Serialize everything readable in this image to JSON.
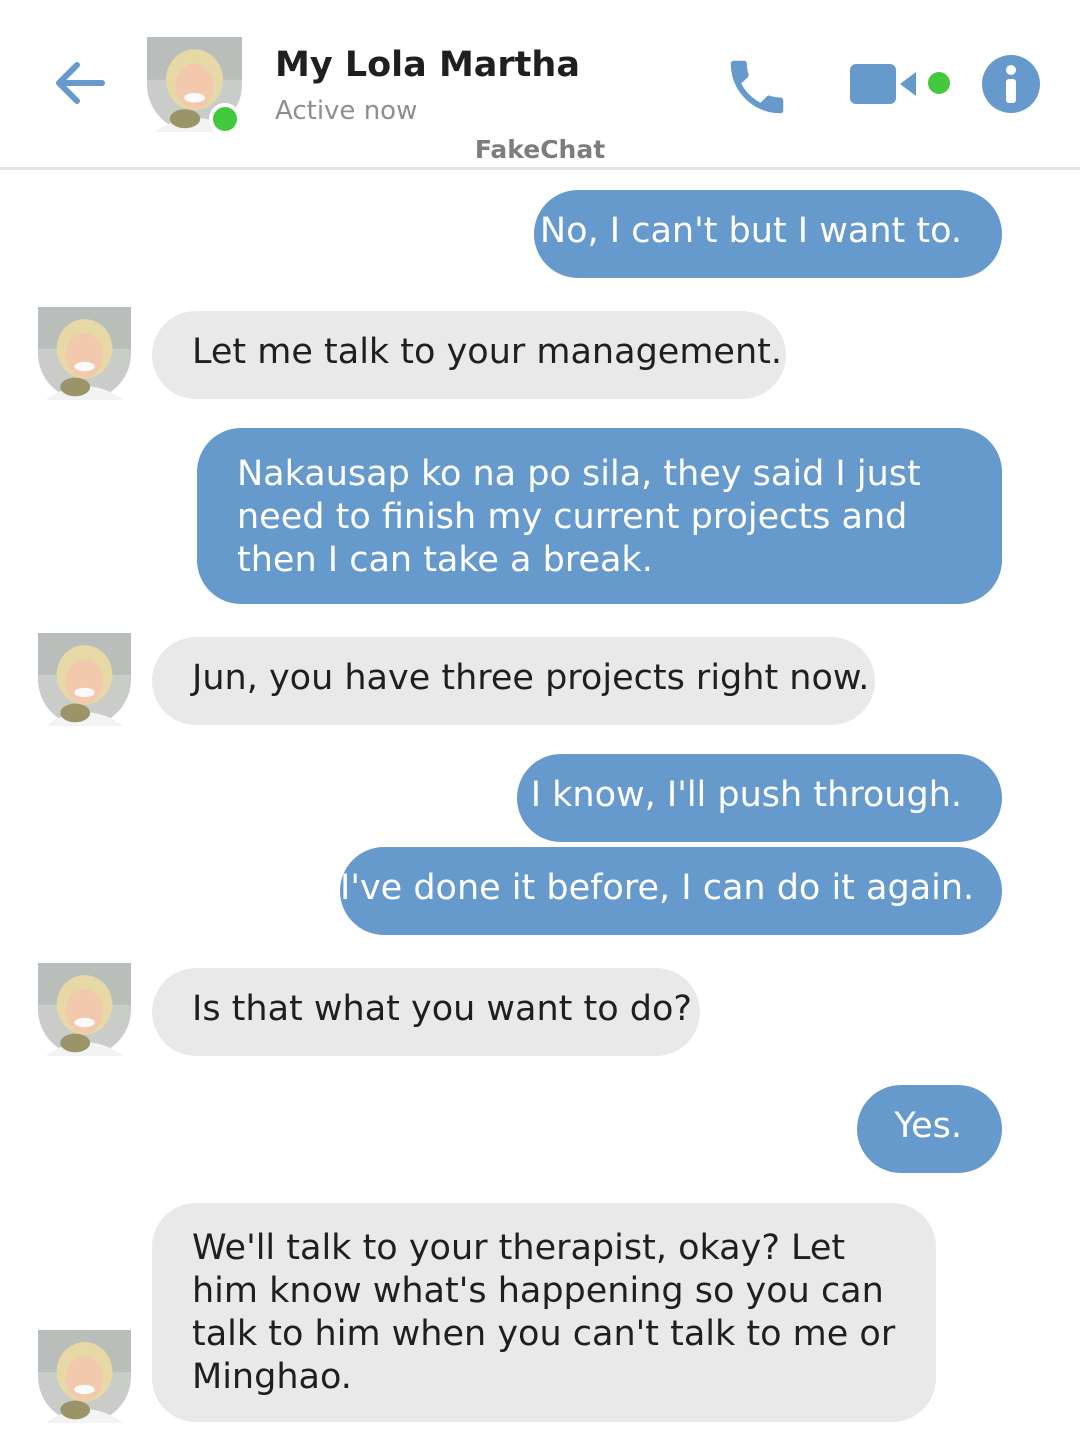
{
  "header": {
    "contact_name": "My Lola Martha",
    "status": "Active now",
    "app_label": "FakeChat",
    "icons": {
      "back": "back-arrow-icon",
      "call": "phone-icon",
      "video": "video-camera-icon",
      "info": "info-icon",
      "online": "online-status-dot"
    }
  },
  "colors": {
    "accent": "#6699cc",
    "outgoing_bubble": "#6699cc",
    "incoming_bubble": "#e9e9e9",
    "online": "#43c93e",
    "divider": "#e2e2e2"
  },
  "messages": [
    {
      "from": "me",
      "text": "No, I can't but I want to."
    },
    {
      "from": "contact",
      "text": "Let me talk to your management."
    },
    {
      "from": "me",
      "text": "Nakausap ko na po sila, they said I just need to finish my current projects and then I can take a break."
    },
    {
      "from": "contact",
      "text": "Jun, you have three projects right now."
    },
    {
      "from": "me",
      "text": "I know, I'll push through."
    },
    {
      "from": "me",
      "text": "I've done it before, I can do it again."
    },
    {
      "from": "contact",
      "text": "Is that what you want to do?"
    },
    {
      "from": "me",
      "text": "Yes."
    },
    {
      "from": "contact",
      "text": "We'll talk to your therapist, okay? Let him know what's happening so you can talk to him when you can't talk to me or Minghao."
    }
  ]
}
